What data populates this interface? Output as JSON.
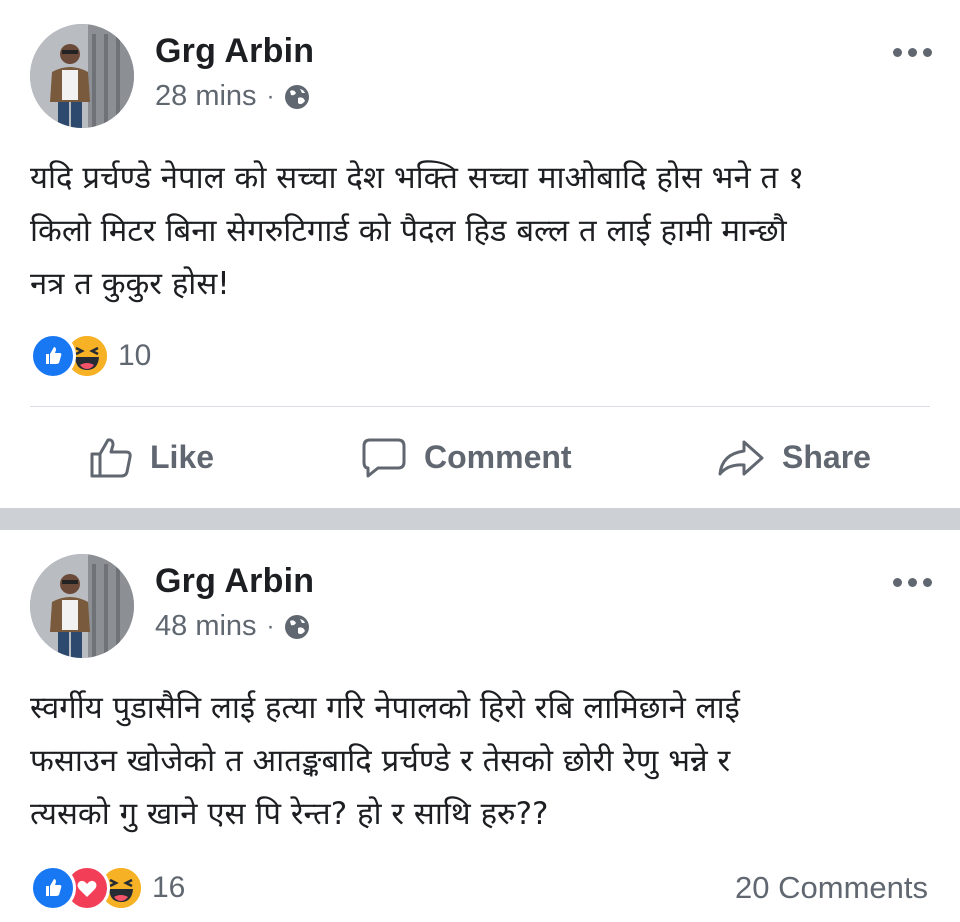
{
  "posts": [
    {
      "author": "Grg Arbin",
      "time": "28 mins",
      "separator": "·",
      "privacy_icon": "globe-icon",
      "text_lines": [
        "यदि प्रर्चण्डे  नेपाल को सच्चा देश भक्ति सच्चा माओबादि होस  भने त १",
        "किलो मिटर बिना सेगरुटिगार्ड को पैदल हिड बल्ल त लाई हामी मान्छौ",
        "नत्र त कुकुर होस!"
      ],
      "reaction_icons": [
        "like-reaction-icon",
        "haha-reaction-icon"
      ],
      "reaction_count": "10",
      "actions": {
        "like": "Like",
        "comment": "Comment",
        "share": "Share"
      }
    },
    {
      "author": "Grg Arbin",
      "time": "48 mins",
      "separator": "·",
      "privacy_icon": "globe-icon",
      "text_lines": [
        "स्वर्गीय पुडासैनि लाई हत्या गरि नेपालको हिरो रबि लामिछाने लाई",
        "फसाउन खोजेको त आतङ्कबादि प्रर्चण्डे र तेसको छोरी रेणु भन्ने र",
        "त्यसको गु खाने एस पि रेन्त? हो र साथि हरु??"
      ],
      "reaction_icons": [
        "like-reaction-icon",
        "love-reaction-icon",
        "haha-reaction-icon"
      ],
      "reaction_count": "16",
      "comments_count": "20 Comments"
    }
  ],
  "colors": {
    "like_blue": "#1877f2",
    "love_red": "#f33e58",
    "haha_yellow": "#f7b125",
    "secondary_text": "#606770",
    "separator": "#cdd0d4"
  }
}
